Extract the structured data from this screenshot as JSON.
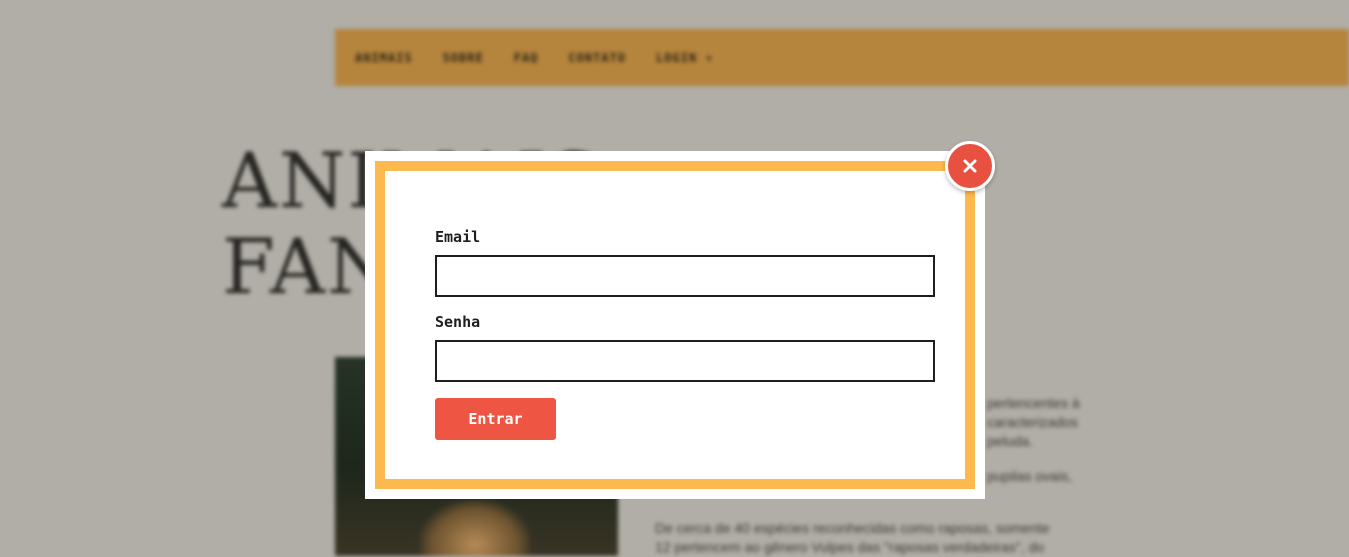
{
  "background": {
    "nav": {
      "items": [
        "ANIMAIS",
        "SOBRE",
        "FAQ",
        "CONTATO",
        "LOGIN ▾"
      ]
    },
    "title_line1": "ANIMAIS",
    "title_line2": "FANTÁSTICOS",
    "paragraphs": [
      "pertencentes à",
      "caracterizados",
      "peluda.",
      "pupilas ovais,",
      "De cerca de 40 espécies reconhecidas como raposas, somente",
      "12 pertencem ao gênero Vulpes das \"raposas verdadeiras\", do"
    ]
  },
  "login_modal": {
    "email_label": "Email",
    "email_value": "",
    "password_label": "Senha",
    "password_value": "",
    "submit_label": "Entrar",
    "close_icon": "close-icon",
    "colors": {
      "border": "#fdb94d",
      "button": "#ef5543",
      "close": "#e8503f"
    }
  }
}
